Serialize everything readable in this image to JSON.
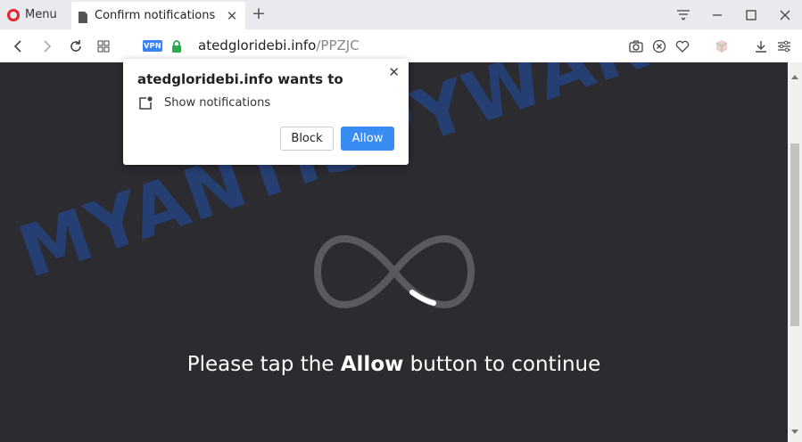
{
  "browser": {
    "menu_label": "Menu",
    "tab_title": "Confirm notifications",
    "vpn_badge": "VPN",
    "url_domain": "atedgloridebi.info",
    "url_path": "/PPZJC"
  },
  "popup": {
    "title": "atedgloridebi.info wants to",
    "permission": "Show notifications",
    "block_label": "Block",
    "allow_label": "Allow"
  },
  "page": {
    "instruction_prefix": "Please tap the ",
    "instruction_bold": "Allow",
    "instruction_suffix": " button to continue",
    "watermark": "MYANTISPYWARE.COM"
  },
  "colors": {
    "accent": "#3a8cf5",
    "opera_red": "#e8242e",
    "page_bg": "#2b2b30"
  }
}
